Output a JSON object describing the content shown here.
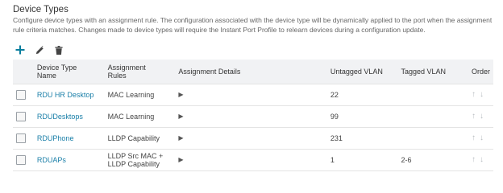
{
  "section": {
    "title": "Device Types",
    "description": "Configure device types with an assignment rule. The configuration associated with the device type will be dynamically applied to the port when the assignment rule criteria matches. Changes made to device types will require the Instant Port Profile to relearn devices during a configuration update."
  },
  "toolbar": {
    "add_icon": "plus-icon",
    "edit_icon": "pencil-icon",
    "delete_icon": "trash-icon",
    "color": "#0a7e9e"
  },
  "table": {
    "columns": [
      "Device Type\nName",
      "Assignment\nRules",
      "Assignment Details",
      "Untagged VLAN",
      "Tagged VLAN",
      "Order"
    ],
    "rows": [
      {
        "name": "RDU HR Desktop",
        "rules": "MAC Learning",
        "details": "▶",
        "untagged": "22",
        "tagged": "",
        "up": "↑",
        "down": "↓"
      },
      {
        "name": "RDUDesktops",
        "rules": "MAC Learning",
        "details": "▶",
        "untagged": "99",
        "tagged": "",
        "up": "↑",
        "down": "↓"
      },
      {
        "name": "RDUPhone",
        "rules": "LLDP Capability",
        "details": "▶",
        "untagged": "231",
        "tagged": "",
        "up": "↑",
        "down": "↓"
      },
      {
        "name": "RDUAPs",
        "rules": "LLDP Src MAC +\nLLDP Capability",
        "details": "▶",
        "untagged": "1",
        "tagged": "2-6",
        "up": "↑",
        "down": "↓"
      }
    ]
  }
}
